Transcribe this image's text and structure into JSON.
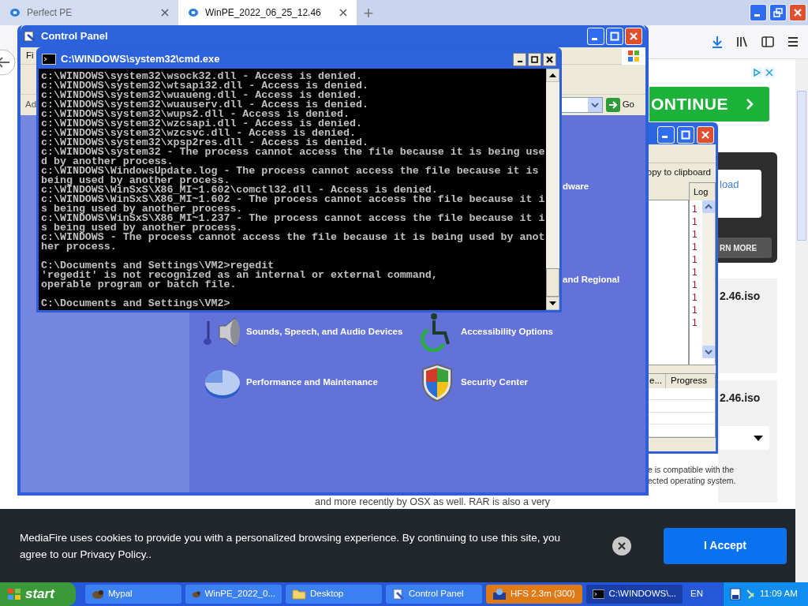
{
  "browser": {
    "tabs": [
      {
        "label": "Perfect PE",
        "selected": false
      },
      {
        "label": "WinPE_2022_06_25_12.46",
        "selected": true
      }
    ],
    "new_tab": "+"
  },
  "page": {
    "ad_button": "ONTINUE",
    "card_link": "load",
    "card_button": "RN MORE",
    "files": [
      {
        "name": "2.46.iso"
      },
      {
        "name": "2.46.iso"
      }
    ],
    "compat_note": "e is compatible with the\nected operating system.",
    "body_text": "and more recently by OSX as well. RAR is also a very"
  },
  "control_panel": {
    "title": "Control Panel",
    "menu_partial": "Fi",
    "address_partial": "Ad",
    "go": "Go",
    "partial_labels": [
      "dware",
      "and Regional"
    ],
    "categories": [
      {
        "label": "Sounds, Speech, and Audio Devices",
        "kind": "sound"
      },
      {
        "label": "Accessibility Options",
        "kind": "accessibility"
      },
      {
        "label": "Performance and Maintenance",
        "kind": "performance"
      },
      {
        "label": "Security Center",
        "kind": "security"
      }
    ]
  },
  "hfs_window": {
    "toolbar_partial": "opy to clipboard",
    "log_header": "Log",
    "log_entries": [
      "1",
      "1",
      "1",
      "1",
      "1",
      "1",
      "1",
      "1",
      "1",
      "1"
    ],
    "columns": [
      "e...",
      "Progress"
    ]
  },
  "cmd": {
    "title": "C:\\WINDOWS\\system32\\cmd.exe",
    "blocks": [
      [
        "c:\\WINDOWS\\system32\\wsock32.dll - Access is denied.",
        "c:\\WINDOWS\\system32\\wtsapi32.dll - Access is denied.",
        "c:\\WINDOWS\\system32\\wuaueng.dll - Access is denied.",
        "c:\\WINDOWS\\system32\\wuauserv.dll - Access is denied.",
        "c:\\WINDOWS\\system32\\wups2.dll - Access is denied.",
        "c:\\WINDOWS\\system32\\wzcsapi.dll - Access is denied.",
        "c:\\WINDOWS\\system32\\wzcsvc.dll - Access is denied.",
        "c:\\WINDOWS\\system32\\xpsp2res.dll - Access is denied.",
        "c:\\WINDOWS\\system32 - The process cannot access the file because it is being use",
        "d by another process.",
        "c:\\WINDOWS\\WindowsUpdate.log - The process cannot access the file because it is",
        "being used by another process.",
        "c:\\WINDOWS\\WinSxS\\X86_MI~1.602\\comctl32.dll - Access is denied.",
        "c:\\WINDOWS\\WinSxS\\X86_MI~1.602 - The process cannot access the file because it i",
        "s being used by another process.",
        "c:\\WINDOWS\\WinSxS\\X86_MI~1.237 - The process cannot access the file because it i",
        "s being used by another process.",
        "c:\\WINDOWS - The process cannot access the file because it is being used by anot",
        "her process."
      ],
      [
        "C:\\Documents and Settings\\VM2>regedit",
        "'regedit' is not recognized as an internal or external command,",
        "operable program or batch file."
      ],
      [
        "C:\\Documents and Settings\\VM2>"
      ]
    ]
  },
  "cookie_bar": {
    "message": "MediaFire uses cookies to provide you with a personalized browsing experience. By continuing to use this site, you agree to our Privacy Policy..",
    "accept": "I Accept"
  },
  "taskbar": {
    "start": "start",
    "items": [
      {
        "label": "Mypal",
        "kind": "browser",
        "selected": false,
        "flashing": false
      },
      {
        "label": "WinPE_2022_0...",
        "kind": "browser",
        "selected": false,
        "flashing": false
      },
      {
        "label": "Desktop",
        "kind": "folder",
        "selected": false,
        "flashing": false
      },
      {
        "label": "Control Panel",
        "kind": "control",
        "selected": false,
        "flashing": false
      },
      {
        "label": "HFS 2.3m (300)",
        "kind": "hfs",
        "selected": false,
        "flashing": true
      },
      {
        "label": "C:\\WINDOWS\\...",
        "kind": "console",
        "selected": true,
        "flashing": false
      }
    ],
    "language": "EN",
    "clock": "11:09 AM"
  }
}
